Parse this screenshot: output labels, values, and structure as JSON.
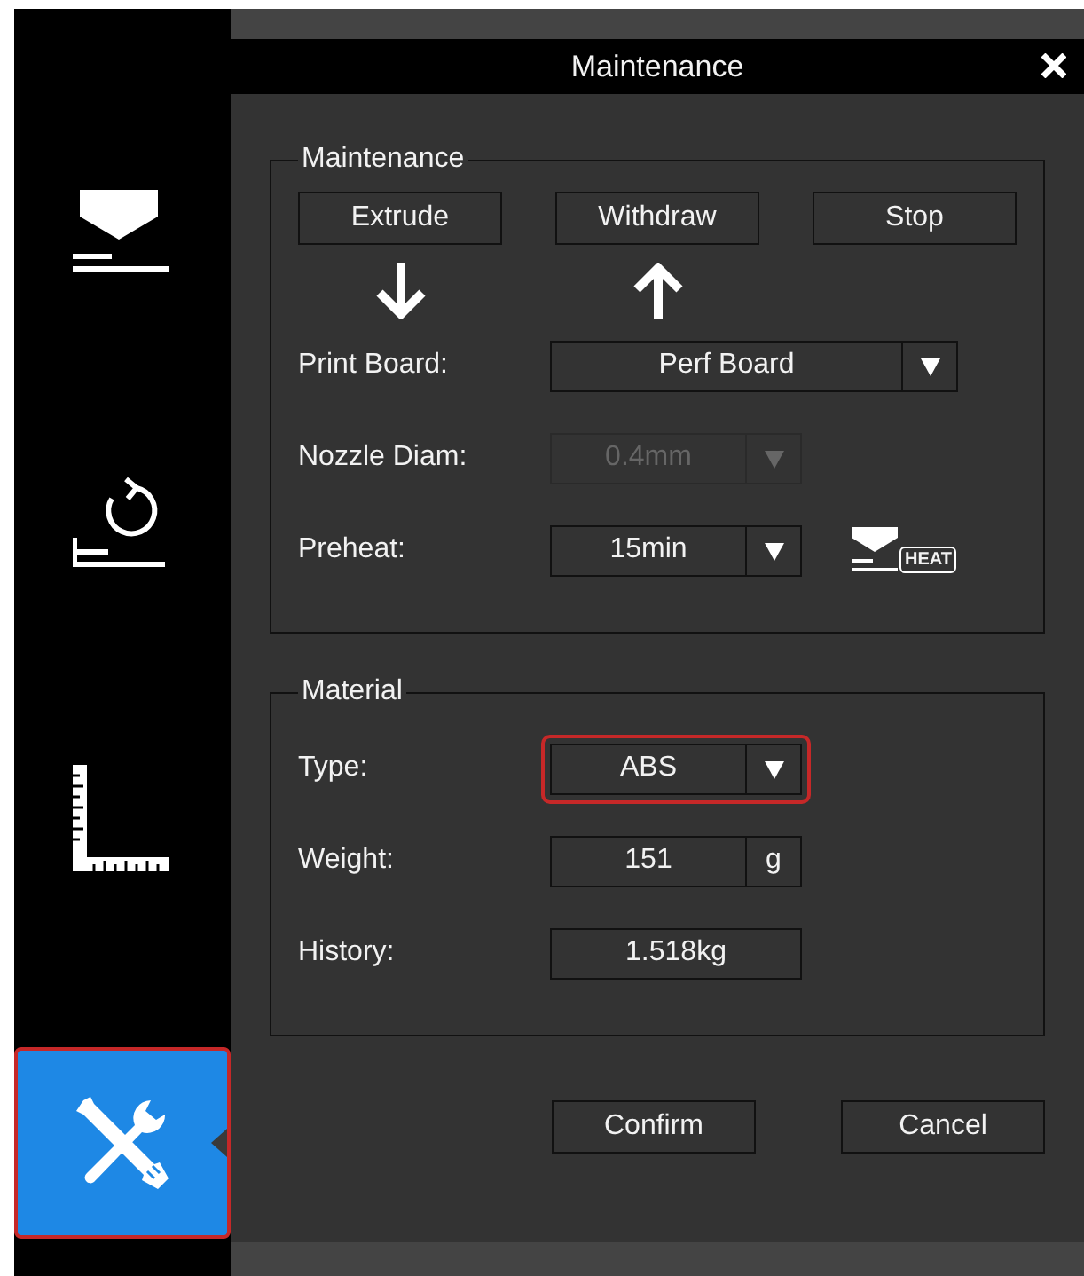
{
  "sidebar": {
    "items": [
      {
        "kind": "nozzle",
        "selected": false,
        "highlighted": false
      },
      {
        "kind": "rotate",
        "selected": false,
        "highlighted": false
      },
      {
        "kind": "ruler",
        "selected": false,
        "highlighted": false
      },
      {
        "kind": "tools",
        "selected": true,
        "highlighted": true
      }
    ]
  },
  "dialog": {
    "title": "Maintenance",
    "groups": [
      {
        "title": "Maintenance",
        "buttons": [
          {
            "label": "Extrude",
            "kind": "extrude"
          },
          {
            "label": "Withdraw",
            "kind": "withdraw"
          },
          {
            "label": "Stop",
            "kind": "stop"
          }
        ],
        "rows": [
          {
            "kind": "wide-select",
            "label": "Print Board:",
            "value": "Perf Board",
            "disabled": false,
            "highlighted": false
          },
          {
            "kind": "select",
            "label": "Nozzle Diam:",
            "value": "0.4mm",
            "disabled": true,
            "highlighted": false
          },
          {
            "kind": "select",
            "label": "Preheat:",
            "value": "15min",
            "disabled": false,
            "highlighted": false,
            "heat_badge": "HEAT"
          }
        ]
      },
      {
        "title": "Material",
        "rows": [
          {
            "kind": "select",
            "label": "Type:",
            "value": "ABS",
            "disabled": false,
            "highlighted": true
          },
          {
            "kind": "unit-field",
            "label": "Weight:",
            "value": "151",
            "unit": "g",
            "disabled": false,
            "highlighted": false
          },
          {
            "kind": "field",
            "label": "History:",
            "value": "1.518kg",
            "disabled": false,
            "highlighted": false
          }
        ]
      }
    ],
    "footer_buttons": [
      "Confirm",
      "Cancel"
    ]
  }
}
